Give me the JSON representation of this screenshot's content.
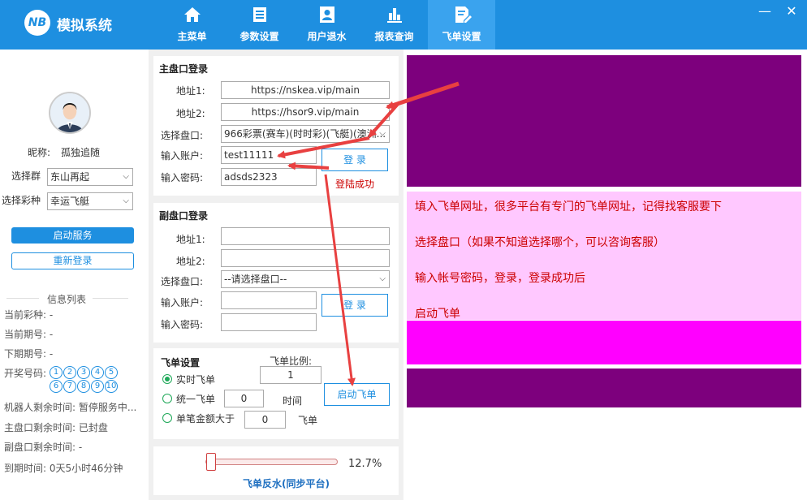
{
  "app": {
    "logo_text": "NB",
    "title": "模拟系统"
  },
  "nav": [
    {
      "label": "主菜单",
      "icon": "home-icon"
    },
    {
      "label": "参数设置",
      "icon": "list-icon"
    },
    {
      "label": "用户退水",
      "icon": "user-icon"
    },
    {
      "label": "报表查询",
      "icon": "chart-icon"
    },
    {
      "label": "飞单设置",
      "icon": "edit-doc-icon"
    }
  ],
  "window": {
    "minimize": "—",
    "close": "✕"
  },
  "profile": {
    "nickname_label": "昵称:",
    "nickname": "孤独追随",
    "group_label": "选择群",
    "group_value": "东山再起",
    "lottery_label": "选择彩种",
    "lottery_value": "幸运飞艇",
    "start_button": "启动服务",
    "relogin_button": "重新登录"
  },
  "info": {
    "title": "信息列表",
    "current_lottery_label": "当前彩种:",
    "current_lottery": "-",
    "current_period_label": "当前期号:",
    "current_period": "-",
    "next_period_label": "下期期号:",
    "next_period": "-",
    "draw_label": "开奖号码:",
    "draw_numbers_row1": [
      "1",
      "2",
      "3",
      "4",
      "5"
    ],
    "draw_numbers_row2": [
      "6",
      "7",
      "8",
      "9",
      "10"
    ],
    "robot_time_label": "机器人剩余时间:",
    "robot_time": "暂停服务中...",
    "main_time_label": "主盘口剩余时间:",
    "main_time": "已封盘",
    "sub_time_label": "副盘口剩余时间:",
    "sub_time": "-",
    "expire_label": "到期时间:",
    "expire": "0天5小时46分钟"
  },
  "main_login": {
    "title": "主盘口登录",
    "addr1_label": "地址1:",
    "addr1": "https://nskea.vip/main",
    "addr2_label": "地址2:",
    "addr2": "https://hsor9.vip/main",
    "market_label": "选择盘口:",
    "market": "966彩票(赛车)(时时彩)(飞艇)(澳洲...",
    "account_label": "输入账户:",
    "account": "test11111",
    "password_label": "输入密码:",
    "password": "adsds2323",
    "login_button": "登 录",
    "status": "登陆成功"
  },
  "sub_login": {
    "title": "副盘口登录",
    "addr1_label": "地址1:",
    "addr1": "",
    "addr2_label": "地址2:",
    "addr2": "",
    "market_label": "选择盘口:",
    "market": "--请选择盘口--",
    "account_label": "输入账户:",
    "account": "",
    "password_label": "输入密码:",
    "password": "",
    "login_button": "登 录"
  },
  "fly": {
    "title": "飞单设置",
    "ratio_label": "飞单比例:",
    "ratio": "1",
    "opt_realtime": "实时飞单",
    "opt_uniform": "统一飞单",
    "uniform_value": "0",
    "uniform_unit": "时间",
    "opt_single": "单笔金额大于",
    "single_value": "0",
    "single_unit": "飞单",
    "start_button": "启动飞单"
  },
  "rebate": {
    "percent": "12.7%",
    "fraction": 0.127,
    "label": "飞单反水(同步平台)"
  },
  "guide": {
    "line1": "填入飞单网址，很多平台有专门的飞单网址，记得找客服要下",
    "line2": "选择盘口（如果不知道选择哪个，可以咨询客服）",
    "line3": "输入帐号密码，登录，登录成功后",
    "line4": "启动飞单"
  },
  "colors": {
    "accent": "#1e8fe0",
    "purple": "#7d007d",
    "pink": "#ffc8ff",
    "magenta": "#ff00ff",
    "arrow": "#e84040"
  }
}
